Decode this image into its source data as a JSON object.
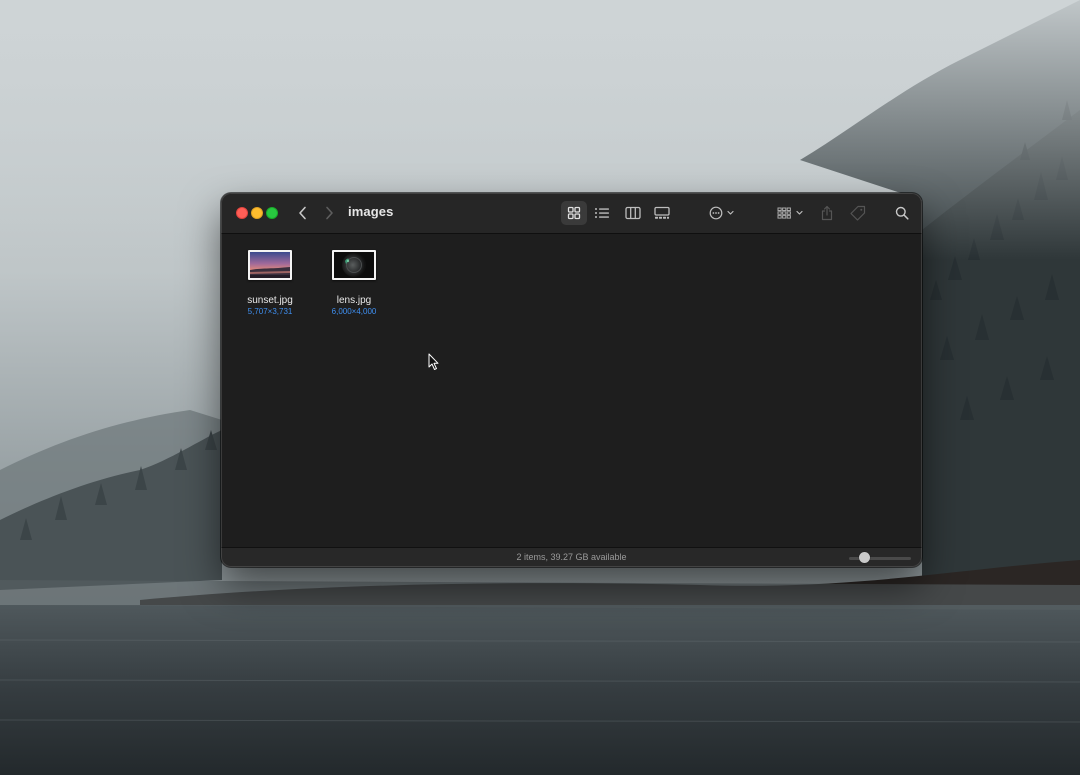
{
  "window": {
    "title": "images"
  },
  "toolbar": {
    "back_icon": "chevron-left-icon",
    "forward_icon": "chevron-right-icon",
    "views": [
      "icon-view-icon",
      "list-view-icon",
      "column-view-icon",
      "gallery-view-icon"
    ],
    "active_view": "icon-view-icon",
    "action_icon": "ellipsis-circle-icon",
    "group_icon": "group-grid-icon",
    "share_icon": "share-icon",
    "tag_icon": "tag-icon",
    "search_icon": "search-icon"
  },
  "files": [
    {
      "name": "sunset.jpg",
      "dimensions": "5,707×3,731"
    },
    {
      "name": "lens.jpg",
      "dimensions": "6,000×4,000"
    }
  ],
  "status": {
    "text": "2 items, 39.27 GB available",
    "zoom_level": 0.25
  },
  "colors": {
    "window_bg": "#1e1e1e",
    "toolbar_bg": "#262626",
    "accent_dims": "#3f8ff0",
    "close": "#ff5f57",
    "minimize": "#febc2e",
    "maximize": "#28c840"
  }
}
